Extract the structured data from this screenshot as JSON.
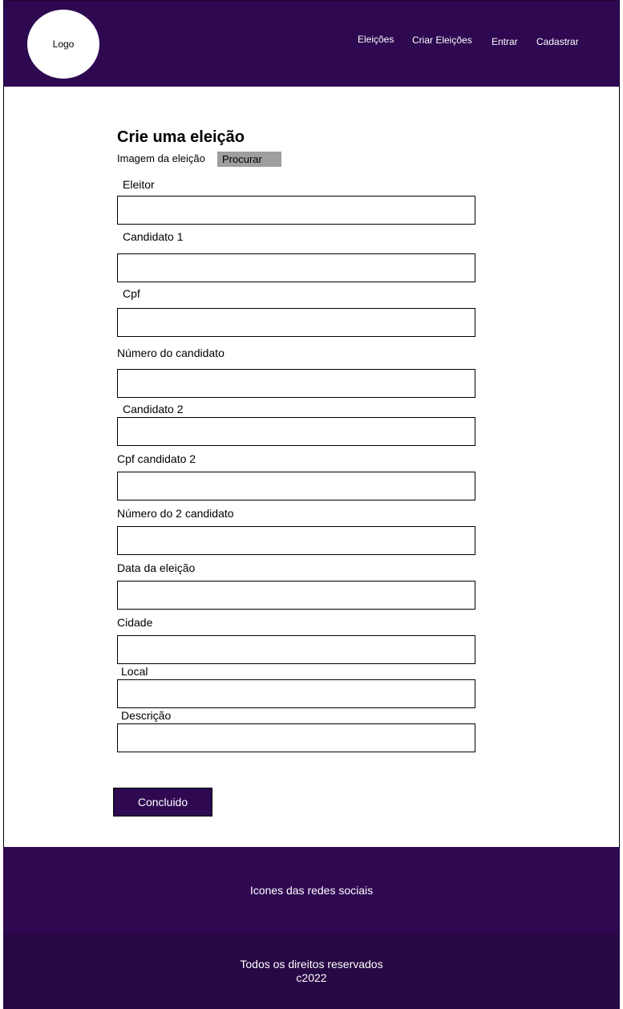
{
  "header": {
    "logo_text": "Logo",
    "nav": [
      {
        "label": "Eleições"
      },
      {
        "label": "Criar Eleições"
      },
      {
        "label": "Entrar"
      },
      {
        "label": "Cadastrar"
      }
    ]
  },
  "form": {
    "title": "Crie uma eleição",
    "image_label": "Imagem da eleição",
    "browse_button": "Procurar",
    "fields": [
      {
        "label": "Eleitor",
        "value": ""
      },
      {
        "label": "Candidato 1",
        "value": ""
      },
      {
        "label": "Cpf",
        "value": ""
      },
      {
        "label": "Número do candidato",
        "value": ""
      },
      {
        "label": "Candidato 2",
        "value": ""
      },
      {
        "label": "Cpf candidato 2",
        "value": ""
      },
      {
        "label": "Número do 2 candidato",
        "value": ""
      },
      {
        "label": "Data da eleição",
        "value": ""
      },
      {
        "label": "Cidade",
        "value": ""
      },
      {
        "label": "Local",
        "value": ""
      },
      {
        "label": "Descrição",
        "value": ""
      }
    ],
    "submit_button": "Concluido"
  },
  "footer": {
    "social_text": "Icones das redes sociais",
    "rights_text": "Todos os direitos reservados",
    "year_text": "c2022"
  },
  "colors": {
    "brand_purple": "#2e0851",
    "footer_dark": "#270844",
    "browse_gray": "#9e9e9e"
  }
}
